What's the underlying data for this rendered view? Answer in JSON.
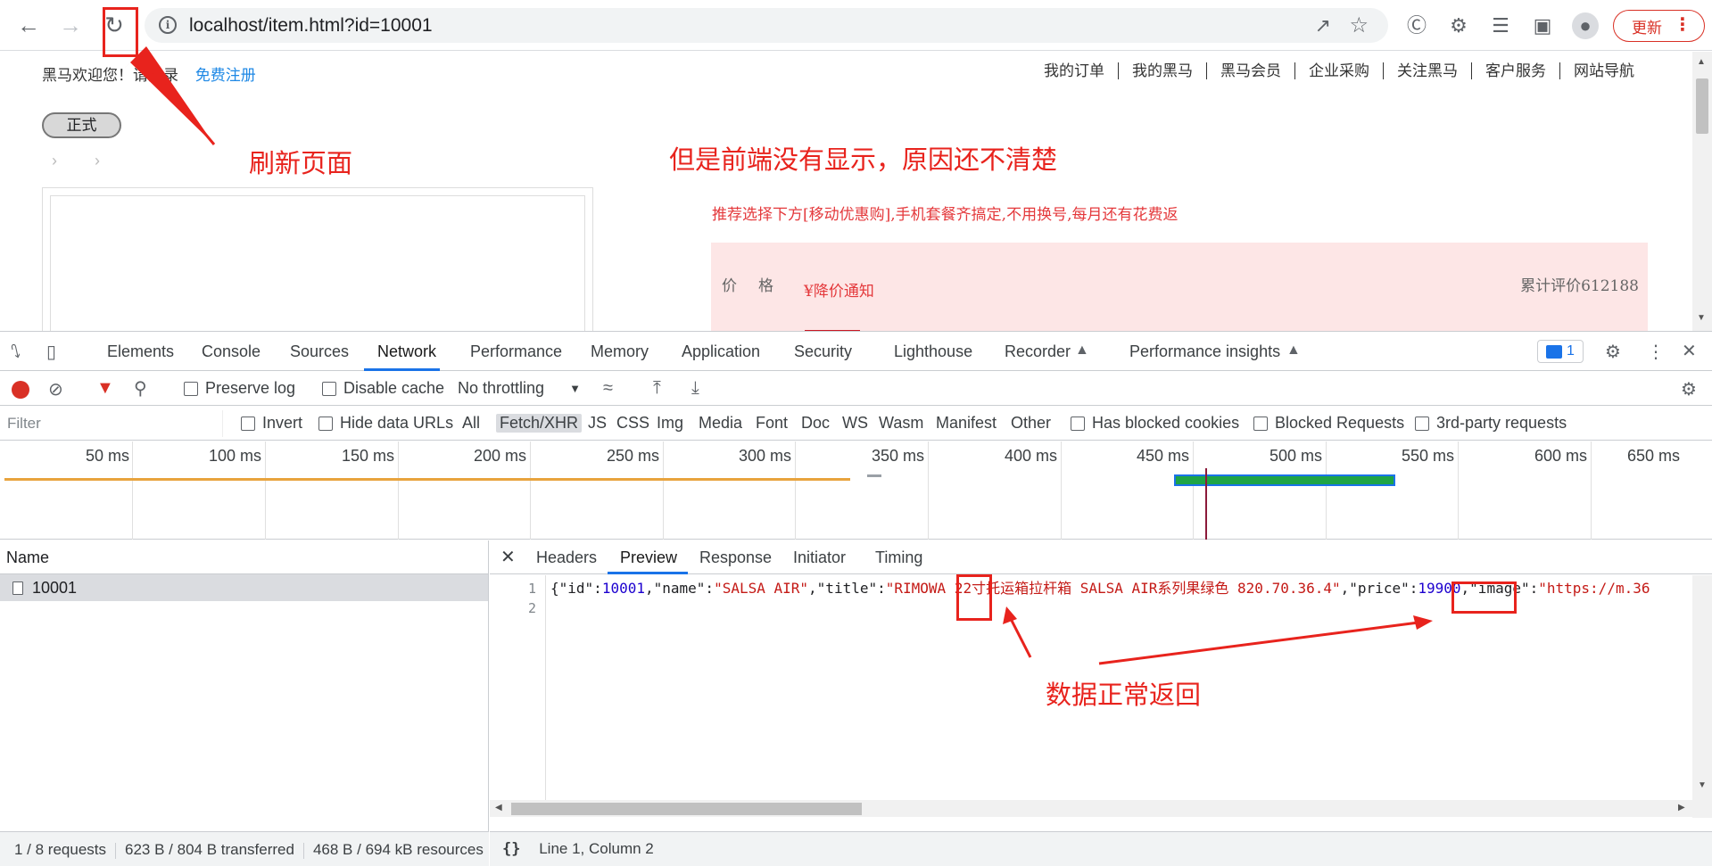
{
  "browser": {
    "url": "localhost/item.html?id=10001",
    "update_label": "更新"
  },
  "page": {
    "welcome": "黑马欢迎您！请登录",
    "register": "免费注册",
    "nav_links": [
      "我的订单",
      "我的黑马",
      "黑马会员",
      "企业采购",
      "关注黑马",
      "客户服务",
      "网站导航"
    ],
    "formal_button": "正式",
    "promo": "推荐选择下方[移动优惠购],手机套餐齐搞定,不用换号,每月还有花费返",
    "price_label": "价格",
    "price_notice": "¥降价通知",
    "comments": "累计评价612188"
  },
  "devtools": {
    "tabs": [
      "Elements",
      "Console",
      "Sources",
      "Network",
      "Performance",
      "Memory",
      "Application",
      "Security",
      "Lighthouse",
      "Recorder",
      "Performance insights"
    ],
    "active_tab": "Network",
    "issues_count": "1",
    "toolbar": {
      "preserve_log": "Preserve log",
      "disable_cache": "Disable cache",
      "throttling": "No throttling"
    },
    "filter": {
      "placeholder": "Filter",
      "invert": "Invert",
      "hide_data_urls": "Hide data URLs",
      "types": [
        "All",
        "Fetch/XHR",
        "JS",
        "CSS",
        "Img",
        "Media",
        "Font",
        "Doc",
        "WS",
        "Wasm",
        "Manifest",
        "Other"
      ],
      "selected_type": "Fetch/XHR",
      "has_blocked_cookies": "Has blocked cookies",
      "blocked_requests": "Blocked Requests",
      "third_party": "3rd-party requests"
    },
    "timeline_ticks": [
      "50 ms",
      "100 ms",
      "150 ms",
      "200 ms",
      "250 ms",
      "300 ms",
      "350 ms",
      "400 ms",
      "450 ms",
      "500 ms",
      "550 ms",
      "600 ms",
      "650 ms"
    ],
    "requests_header": "Name",
    "requests": [
      {
        "name": "10001"
      }
    ],
    "status": {
      "requests": "1 / 8 requests",
      "transferred": "623 B / 804 B transferred",
      "resources": "468 B / 694 kB resources"
    },
    "detail_tabs": [
      "Headers",
      "Preview",
      "Response",
      "Initiator",
      "Timing"
    ],
    "active_detail_tab": "Preview",
    "preview_line_numbers": [
      "1",
      "2"
    ],
    "preview_json": {
      "p1": "{",
      "k_id": "\"id\"",
      "v_id": "10001",
      "k_name": "\"name\"",
      "v_name": "\"SALSA AIR\"",
      "k_title": "\"title\"",
      "v_title": "\"RIMOWA 22寸托运箱拉杆箱 SALSA AIR系列果绿色 820.70.36.4\"",
      "k_price": "\"price\"",
      "v_price": "19900",
      "k_image": "\"image\"",
      "v_image": "\"https://m.36"
    },
    "cursor_position": "Line 1, Column 2"
  },
  "annotations": {
    "refresh": "刷新页面",
    "frontend_missing": "但是前端没有显示，原因还不清楚",
    "data_returned": "数据正常返回"
  }
}
